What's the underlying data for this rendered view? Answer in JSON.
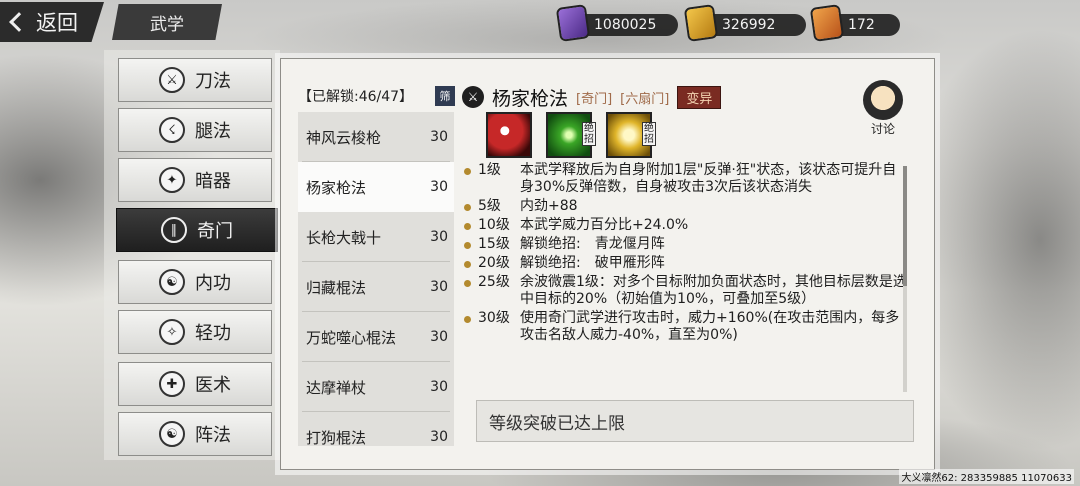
{
  "nav": {
    "back_label": "返回",
    "page_title": "武学"
  },
  "currencies": [
    {
      "name": "purple-jade",
      "value": "1080025",
      "color": "#7b4fc0"
    },
    {
      "name": "gold-token",
      "value": "326992",
      "color": "#d9a12a"
    },
    {
      "name": "orange-token",
      "value": "172",
      "color": "#d8742a"
    }
  ],
  "categories": [
    {
      "label": "刀法",
      "icon": "saber-icon"
    },
    {
      "label": "腿法",
      "icon": "kick-icon"
    },
    {
      "label": "暗器",
      "icon": "dart-icon"
    },
    {
      "label": "奇门",
      "icon": "exotic-weapon-icon",
      "selected": true
    },
    {
      "label": "内功",
      "icon": "inner-power-icon"
    },
    {
      "label": "轻功",
      "icon": "lightness-icon"
    },
    {
      "label": "医术",
      "icon": "medicine-icon"
    },
    {
      "label": "阵法",
      "icon": "formation-icon"
    }
  ],
  "list": {
    "header": "【已解锁:46/47】",
    "filter_label": "筛",
    "items": [
      {
        "name": "神风云梭枪",
        "level": "30"
      },
      {
        "name": "杨家枪法",
        "level": "30",
        "selected": true
      },
      {
        "name": "长枪大戟十",
        "level": "30"
      },
      {
        "name": "归藏棍法",
        "level": "30"
      },
      {
        "name": "万蛇噬心棍法",
        "level": "30"
      },
      {
        "name": "达摩禅杖",
        "level": "30"
      },
      {
        "name": "打狗棍法",
        "level": "30"
      }
    ]
  },
  "detail": {
    "title": "杨家枪法",
    "tag1": "[奇门]",
    "tag2": "[六扇门]",
    "tag3": "变异",
    "discuss_label": "讨论",
    "move_badge": "绝招",
    "effects": [
      {
        "level": "1级",
        "text": "本武学释放后为自身附加1层\"反弹·狂\"状态，该状态可提升自身30%反弹倍数，自身被攻击3次后该状态消失"
      },
      {
        "level": "5级",
        "text": "内劲+88"
      },
      {
        "level": "10级",
        "text": "本武学威力百分比+24.0%"
      },
      {
        "level": "15级",
        "text": "解锁绝招:　青龙偃月阵"
      },
      {
        "level": "20级",
        "text": "解锁绝招:　破甲雁形阵"
      },
      {
        "level": "25级",
        "text": "余波微震1级：对多个目标附加负面状态时，其他目标层数是选中目标的20%（初始值为10%，可叠加至5级）"
      },
      {
        "level": "30级",
        "text": "使用奇门武学进行攻击时，威力+160%(在攻击范围内，每多攻击名敌人威力-40%，直至为0%)"
      }
    ],
    "limit_text": "等级突破已达上限"
  },
  "watermark": "大义凛然62: 283359885  11070633"
}
